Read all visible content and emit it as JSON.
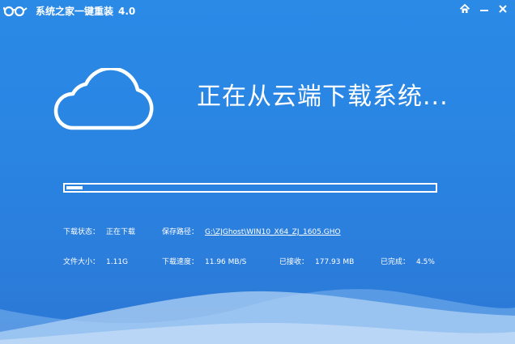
{
  "app": {
    "title": "系统之家一键重装",
    "version": "4.0"
  },
  "heading": "正在从云端下载系统...",
  "progress": {
    "fraction": 0.045
  },
  "info": {
    "download_status_label": "下载状态：",
    "download_status_value": "正在下载",
    "save_path_label": "保存路径：",
    "save_path_value": "G:\\ZJGhost\\WIN10_X64_ZJ_1605.GHO",
    "file_size_label": "文件大小：",
    "file_size_value": "1.11G",
    "speed_label": "下载速度：",
    "speed_value": "11.96 MB/S",
    "received_label": "已接收：",
    "received_value": "177.93 MB",
    "completed_label": "已完成：",
    "completed_value": "4.5%"
  },
  "colors": {
    "background": "#2a86e4",
    "foreground": "#ffffff",
    "wave_light": "#a9cdf3",
    "wave_mid": "#7fb4ee"
  },
  "icons": {
    "logo": "glasses-logo-icon",
    "home": "home-icon",
    "minimize": "minimize-icon",
    "close": "close-icon",
    "hero": "cloud-icon"
  }
}
